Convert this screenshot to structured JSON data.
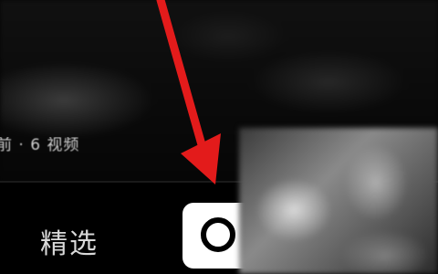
{
  "caption": {
    "text": "前 · 6 视频"
  },
  "bottom_bar": {
    "featured_tab_label": "精选"
  },
  "capture_button": {
    "icon": "record-ring-icon"
  },
  "annotation": {
    "arrow_color": "#e31b1b",
    "icon": "pointer-arrow-icon"
  }
}
